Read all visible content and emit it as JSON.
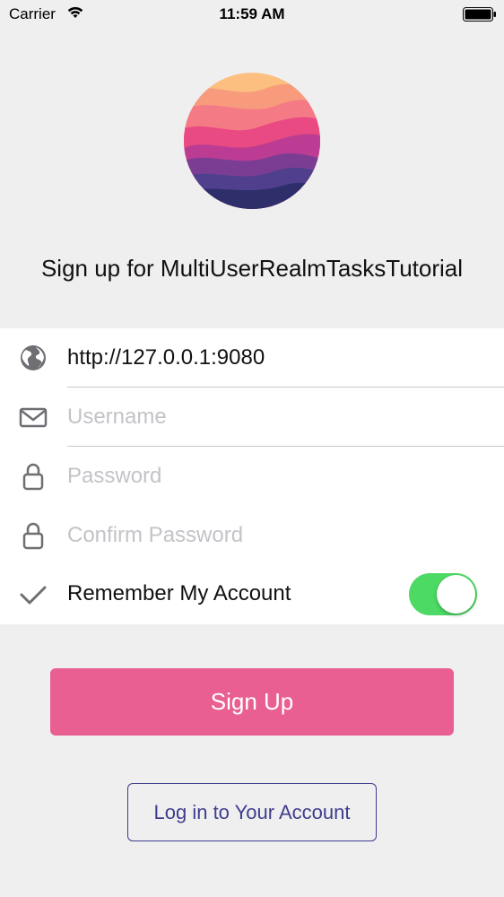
{
  "status_bar": {
    "carrier": "Carrier",
    "time": "11:59 AM"
  },
  "title": "Sign up for MultiUserRealmTasksTutorial",
  "form": {
    "server_url": {
      "value": "http://127.0.0.1:9080",
      "icon": "globe-icon"
    },
    "username": {
      "value": "",
      "placeholder": "Username",
      "icon": "envelope-icon"
    },
    "password": {
      "value": "",
      "placeholder": "Password",
      "icon": "lock-icon"
    },
    "confirm_password": {
      "value": "",
      "placeholder": "Confirm Password",
      "icon": "lock-icon"
    },
    "remember": {
      "label": "Remember My Account",
      "icon": "checkmark-icon",
      "enabled": true
    }
  },
  "buttons": {
    "sign_up": "Sign Up",
    "log_in": "Log in to Your Account"
  },
  "colors": {
    "accent": "#e95f92",
    "secondary": "#3f3d8c",
    "toggle_on": "#4cd964",
    "background": "#efeff0"
  }
}
